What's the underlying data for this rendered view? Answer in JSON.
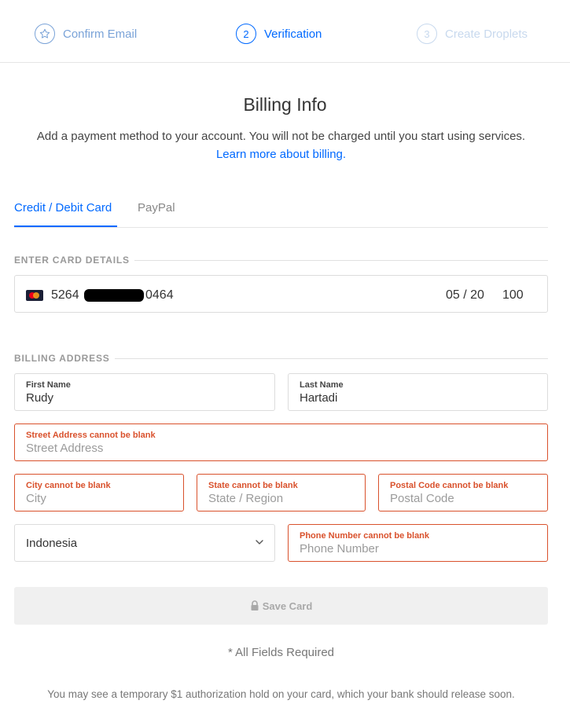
{
  "steps": [
    {
      "number": "",
      "label": "Confirm Email",
      "icon": "star-icon"
    },
    {
      "number": "2",
      "label": "Verification"
    },
    {
      "number": "3",
      "label": "Create Droplets"
    }
  ],
  "header": {
    "title": "Billing Info",
    "subtitle": "Add a payment method to your account. You will not be charged until you start using services.",
    "learn_more": "Learn more about billing."
  },
  "tabs": [
    {
      "label": "Credit / Debit Card",
      "active": true
    },
    {
      "label": "PayPal",
      "active": false
    }
  ],
  "card_section": {
    "label": "ENTER CARD DETAILS",
    "brand_icon": "mastercard-icon",
    "number_prefix": "5264",
    "number_suffix": "0464",
    "expiry": "05 / 20",
    "cvc": "100"
  },
  "address_section": {
    "label": "BILLING ADDRESS",
    "first_name": {
      "label": "First Name",
      "value": "Rudy"
    },
    "last_name": {
      "label": "Last Name",
      "value": "Hartadi"
    },
    "street": {
      "error": "Street Address cannot be blank",
      "placeholder": "Street Address"
    },
    "city": {
      "error": "City cannot be blank",
      "placeholder": "City"
    },
    "state": {
      "error": "State cannot be blank",
      "placeholder": "State / Region"
    },
    "postal": {
      "error": "Postal Code cannot be blank",
      "placeholder": "Postal Code"
    },
    "country": {
      "value": "Indonesia"
    },
    "phone": {
      "error": "Phone Number cannot be blank",
      "placeholder": "Phone Number"
    }
  },
  "save_button": {
    "label": "Save Card",
    "icon": "lock-icon"
  },
  "footer": {
    "required_note": "* All Fields Required",
    "hold_note": "You may see a temporary $1 authorization hold on your card, which your bank should release soon."
  },
  "colors": {
    "accent": "#0069ff",
    "error": "#d9512c",
    "disabled_bg": "#f0f0f0"
  }
}
